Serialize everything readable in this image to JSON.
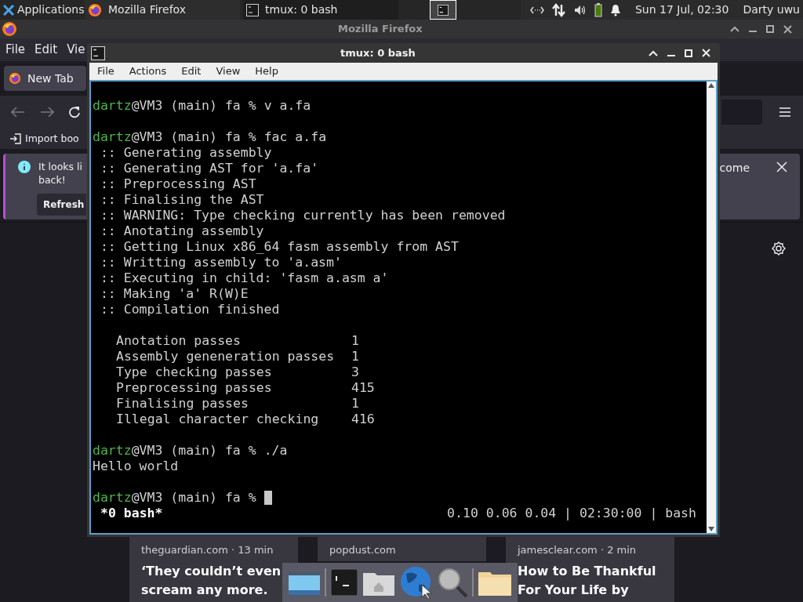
{
  "top_panel": {
    "menu_label": "Applications",
    "tasks": [
      {
        "title": "Mozilla Firefox",
        "kind": "firefox",
        "selected": false
      },
      {
        "title": "tmux: 0 bash",
        "kind": "terminal",
        "selected": true
      }
    ],
    "clock": "Sun 17 Jul, 02:30",
    "user": "Darty uwu"
  },
  "firefox": {
    "title": "Mozilla Firefox",
    "menu": [
      "File",
      "Edit",
      "Vie"
    ],
    "tab": "New Tab",
    "bookmark": "Import boo",
    "notification": {
      "text_start": "It looks li",
      "text_line2": "back!",
      "text_end": "come",
      "button": "Refresh"
    },
    "stories": [
      {
        "source": "theguardian.com · 13 min",
        "headline": [
          "‘They couldn’t even",
          "scream any more."
        ]
      },
      {
        "source": "popdust.com"
      },
      {
        "source": "jamesclear.com · 2 min",
        "headline": [
          "How to Be Thankful",
          "For Your Life by"
        ]
      }
    ]
  },
  "terminal": {
    "title": "tmux: 0 bash",
    "menu": [
      "File",
      "Actions",
      "Edit",
      "View",
      "Help"
    ],
    "lines": [
      {
        "kind": "blank"
      },
      {
        "kind": "prompt",
        "user": "dartz",
        "rest": "@VM3 (main) fa %",
        "command": "v a.fa"
      },
      {
        "kind": "blank"
      },
      {
        "kind": "prompt",
        "user": "dartz",
        "rest": "@VM3 (main) fa %",
        "command": "fac a.fa"
      },
      {
        "kind": "output",
        "text": " :: Generating assembly"
      },
      {
        "kind": "output",
        "text": " :: Generating AST for 'a.fa'"
      },
      {
        "kind": "output",
        "text": " :: Preprocessing AST"
      },
      {
        "kind": "output",
        "text": " :: Finalising the AST"
      },
      {
        "kind": "output",
        "text": " :: WARNING: Type checking currently has been removed"
      },
      {
        "kind": "output",
        "text": " :: Anotating assembly"
      },
      {
        "kind": "output",
        "text": " :: Getting Linux x86_64 fasm assembly from AST"
      },
      {
        "kind": "output",
        "text": " :: Writting assembly to 'a.asm'"
      },
      {
        "kind": "output",
        "text": " :: Executing in child: 'fasm a.asm a'"
      },
      {
        "kind": "output",
        "text": " :: Making 'a' R(W)E"
      },
      {
        "kind": "output",
        "text": " :: Compilation finished"
      },
      {
        "kind": "blank"
      },
      {
        "kind": "stat",
        "label": "Anotation passes",
        "value": "1"
      },
      {
        "kind": "stat",
        "label": "Assembly geneneration passes",
        "value": "1"
      },
      {
        "kind": "stat",
        "label": "Type checking passes",
        "value": "3"
      },
      {
        "kind": "stat",
        "label": "Preprocessing passes",
        "value": "415"
      },
      {
        "kind": "stat",
        "label": "Finalising passes",
        "value": "1"
      },
      {
        "kind": "stat",
        "label": "Illegal character checking",
        "value": "416"
      },
      {
        "kind": "blank"
      },
      {
        "kind": "prompt",
        "user": "dartz",
        "rest": "@VM3 (main) fa %",
        "command": "./a"
      },
      {
        "kind": "output",
        "text": "Hello world"
      },
      {
        "kind": "blank"
      },
      {
        "kind": "prompt",
        "user": "dartz",
        "rest": "@VM3 (main) fa %",
        "cursor": true
      }
    ],
    "status": {
      "window": "*0 bash*",
      "right": "0.10 0.06 0.04 | 02:30:00 | bash"
    }
  },
  "dock": [
    {
      "kind": "desktop"
    },
    {
      "kind": "separator"
    },
    {
      "kind": "terminal"
    },
    {
      "kind": "home"
    },
    {
      "kind": "globe"
    },
    {
      "kind": "search"
    },
    {
      "kind": "separator"
    },
    {
      "kind": "folder"
    }
  ]
}
